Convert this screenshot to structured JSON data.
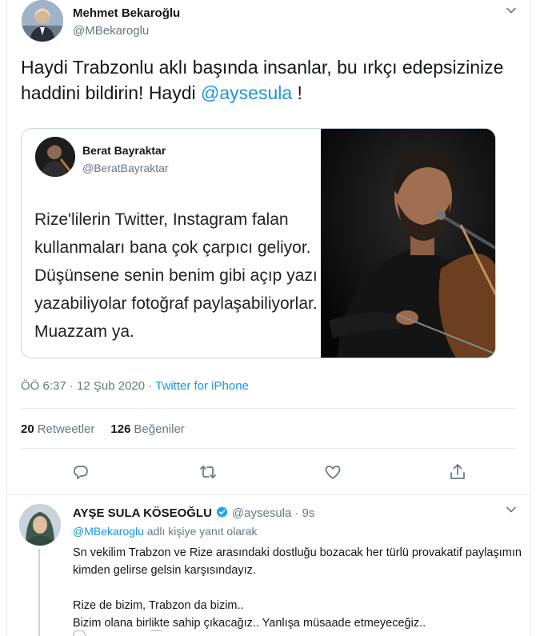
{
  "main_tweet": {
    "author_name": "Mehmet Bekaroğlu",
    "author_handle": "@MBekaroglu",
    "text_before": "Haydi Trabzonlu aklı başında insanlar, bu ırkçı edepsizinize haddini bildirin! Haydi ",
    "text_mention": "@aysesula",
    "text_after": " !",
    "quoted": {
      "author_name": "Berat Bayraktar",
      "author_handle": "@BeratBayraktar",
      "lines": [
        "Rize'lilerin Twitter, Instagram falan",
        "kullanmaları bana çok çarpıcı geliyor.",
        "Düşünsene senin benim gibi açıp yazı",
        "yazabiliyolar fotoğraf paylaşabiliyorlar.",
        "Muazzam ya."
      ]
    },
    "timestamp": "ÖÖ 6:37 · 12 Şub 2020 · ",
    "source": "Twitter for iPhone",
    "retweet_count": "20",
    "retweet_label": "Retweetler",
    "like_count": "126",
    "like_label": "Beğeniler"
  },
  "reply": {
    "author_name": "AYŞE SULA KÖSEOĞLU",
    "author_handle": "@aysesula · 9s",
    "replying_mention": "@MBekaroglu",
    "replying_suffix": " adlı kişiye yanıt olarak",
    "paragraph1": "Sn vekilim Trabzon ve Rize arasındaki dostluğu bozacak her türlü provakatif paylaşımın kimden gelirse gelsin karşısındayız.",
    "paragraph2_line1": "Rize de bizim, Trabzon da bizim..",
    "paragraph2_line2": "Bizim olana birlikte sahip çıkacağız.. Yanlışa müsaade etmeyeceğiz.."
  },
  "icons": {
    "reply": "reply-icon",
    "retweet": "retweet-icon",
    "like": "heart-icon",
    "share": "share-icon",
    "more": "chevron-down-icon",
    "verified": "verified-badge-icon"
  },
  "colors": {
    "link": "#1b95e0",
    "secondary_text": "#657786",
    "verified": "#1da1f2"
  }
}
